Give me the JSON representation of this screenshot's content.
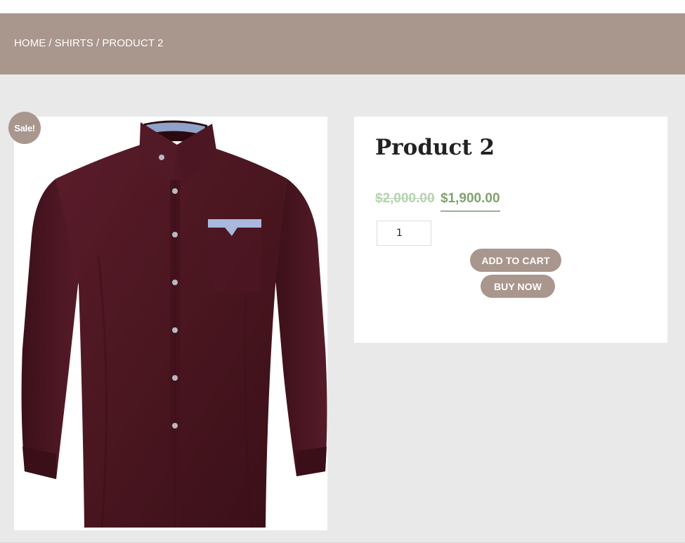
{
  "breadcrumb": {
    "home": "HOME",
    "category": "SHIRTS",
    "current": "PRODUCT 2",
    "separator": "/"
  },
  "product": {
    "badge": "Sale!",
    "title": "Product 2",
    "old_price": "$2,000.00",
    "new_price": "$1,900.00",
    "quantity": "1",
    "image_icon": "shirt-image",
    "image_description_color": "#4a1620"
  },
  "actions": {
    "add_to_cart": "ADD TO CART",
    "buy_now": "BUY NOW"
  },
  "colors": {
    "accent": "#a9968d",
    "background": "#e9e9e9",
    "price_sale": "#7fa36f",
    "price_old": "#b5d3b0"
  }
}
